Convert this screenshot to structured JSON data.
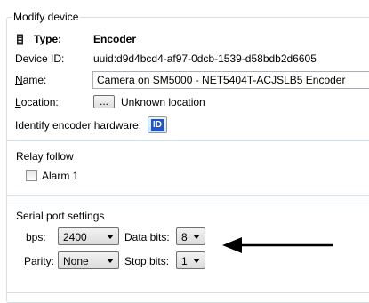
{
  "section_title": "Modify device",
  "type": {
    "label": "Type:",
    "value": "Encoder",
    "icon": "encoder-icon"
  },
  "device_id": {
    "label": "Device ID:",
    "value": "uuid:d9d4bcd4-af97-0dcb-1539-d58bdb2d6605"
  },
  "name": {
    "label_first": "N",
    "label_rest": "ame:",
    "value": "Camera on SM5000 - NET5404T-ACJSLB5 Encoder"
  },
  "location": {
    "label_first": "L",
    "label_rest": "ocation:",
    "button": "...",
    "value": "Unknown location"
  },
  "identify": {
    "label": "Identify encoder hardware:",
    "button": "ID"
  },
  "relay": {
    "title": "Relay follow",
    "alarm_label": "Alarm 1",
    "alarm_checked": false
  },
  "serial": {
    "title": "Serial port settings",
    "bps_label": "bps:",
    "bps_value": "2400",
    "databits_label": "Data bits:",
    "databits_value": "8",
    "parity_label": "Parity:",
    "parity_value": "None",
    "stopbits_label": "Stop bits:",
    "stopbits_value": "1"
  },
  "colors": {
    "border": "#d5dfe5",
    "id_button": "#1e55c8",
    "arrow": "#000000"
  },
  "annotation": {
    "icon": "arrow-left-icon"
  }
}
